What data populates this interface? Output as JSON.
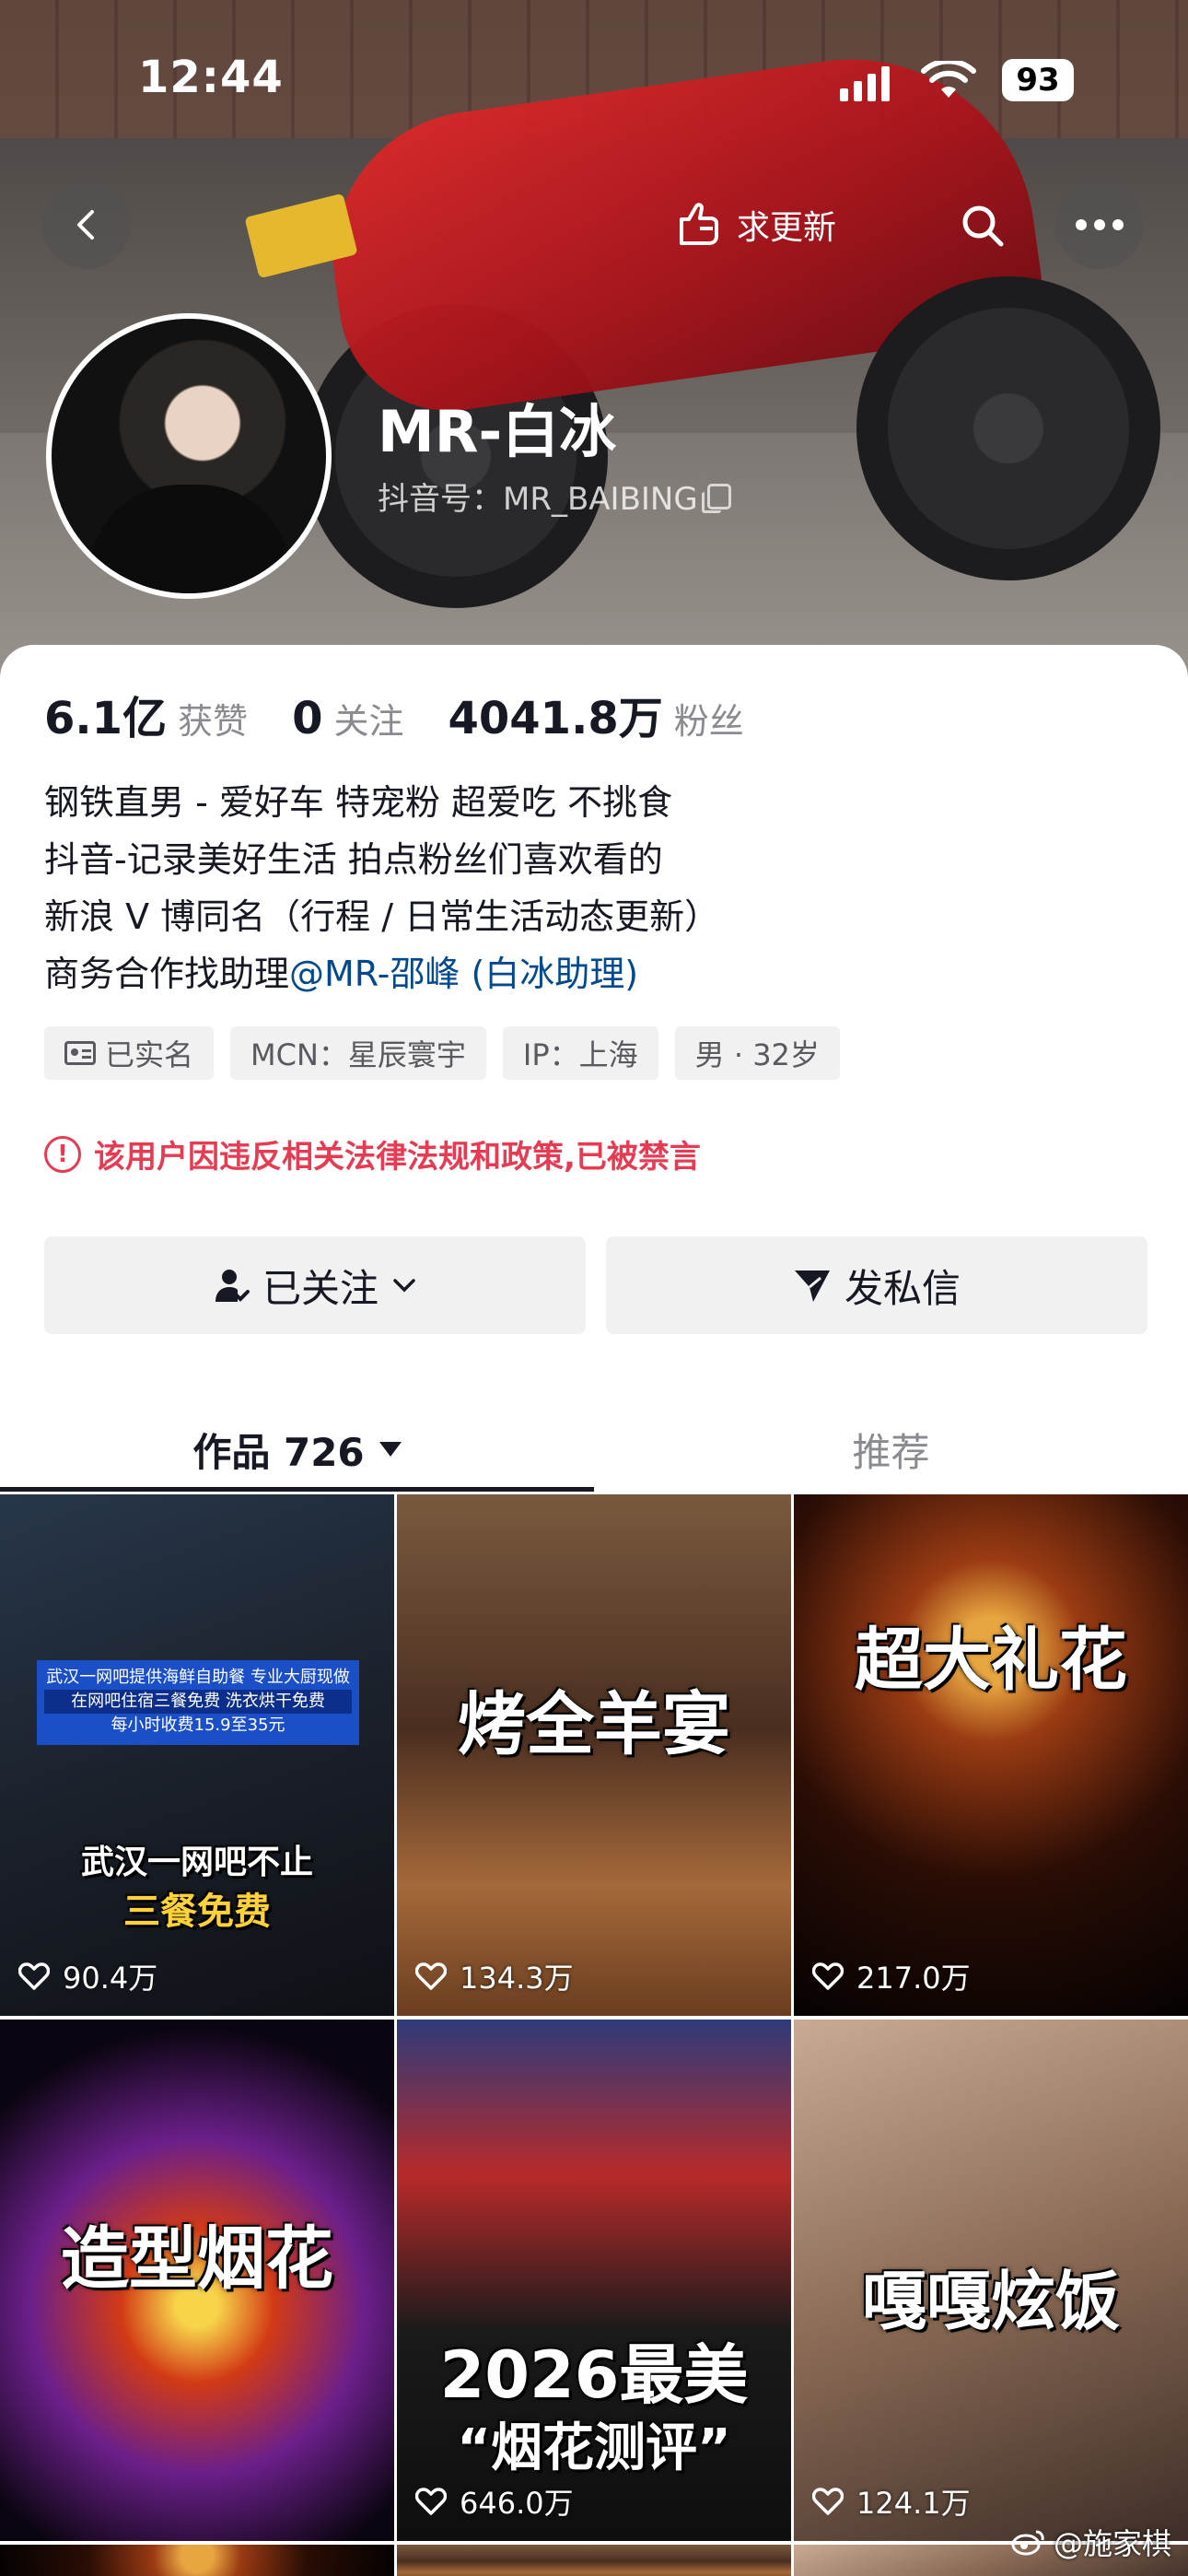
{
  "status_bar": {
    "time": "12:44",
    "battery": "93"
  },
  "nav": {
    "update_label": "求更新"
  },
  "profile": {
    "name": "MR-白冰",
    "douyin_id": "抖音号：MR_BAIBING"
  },
  "stats": [
    {
      "value": "6.1亿",
      "label": "获赞"
    },
    {
      "value": "0",
      "label": "关注"
    },
    {
      "value": "4041.8万",
      "label": "粉丝"
    }
  ],
  "bio": {
    "line1": "钢铁直男 - 爱好车 特宠粉 超爱吃 不挑食",
    "line2": "抖音-记录美好生活 拍点粉丝们喜欢看的",
    "line3": "新浪 V 博同名（行程 / 日常生活动态更新）",
    "line4_prefix": "商务合作找助理",
    "line4_mention": "@MR-邵峰 (白冰助理)"
  },
  "tags": [
    "已实名",
    "MCN：星辰寰宇",
    "IP：上海",
    "男 · 32岁"
  ],
  "warning": "该用户因违反相关法律法规和政策,已被禁言",
  "buttons": {
    "follow": "已关注",
    "message": "发私信"
  },
  "tabs": {
    "works": "作品 726",
    "recommend": "推荐"
  },
  "videos": [
    {
      "caption_line1": "武汉一网吧不止",
      "caption_line2": "三餐免费",
      "likes": "90.4万",
      "banner_top": "武汉一网吧提供海鲜自助餐 专业大厨现做",
      "banner_mid": "在网吧住宿三餐免费 洗衣烘干免费",
      "banner_bottom": "每小时收费15.9至35元"
    },
    {
      "caption": "烤全羊宴",
      "likes": "134.3万"
    },
    {
      "caption": "超大礼花",
      "likes": "217.0万"
    },
    {
      "caption": "造型烟花",
      "likes": ""
    },
    {
      "caption_line1": "2026最美",
      "caption_line2": "“烟花测评”",
      "likes": "646.0万"
    },
    {
      "caption": "嘎嘎炫饭",
      "likes": "124.1万"
    }
  ],
  "watermark": "@施家棋"
}
